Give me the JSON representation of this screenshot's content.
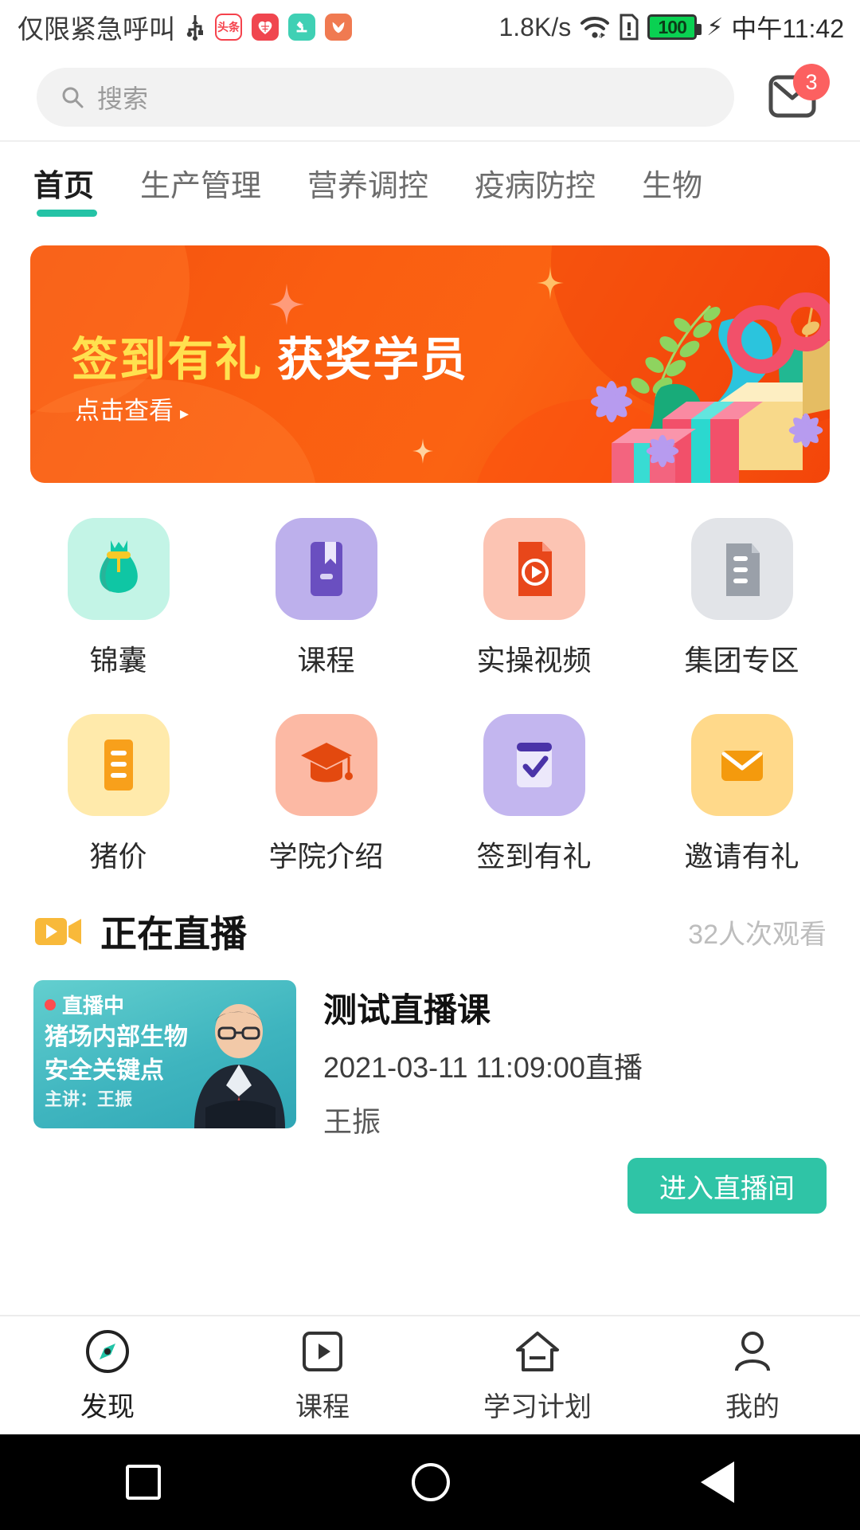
{
  "statusbar": {
    "carrier": "仅限紧急呼叫",
    "usb_icon": "usb-icon",
    "app_icons": [
      {
        "name": "toutiao-icon",
        "label": "头条",
        "bg": "#ffffff",
        "fg": "#f5424c"
      },
      {
        "name": "health-heart-icon",
        "label": "",
        "bg": "#f0464f",
        "fg": "#ffffff"
      },
      {
        "name": "microscope-app-icon",
        "label": "",
        "bg": "#3fd0b4",
        "fg": "#ffffff"
      },
      {
        "name": "plant-app-icon",
        "label": "",
        "bg": "#f07a51",
        "fg": "#ffffff"
      }
    ],
    "network_speed": "1.8K/s",
    "wifi_icon": "wifi-icon",
    "sim_icon": "sim-alert-icon",
    "battery_level": "100",
    "battery_color": "#0ad152",
    "charging_icon": "bolt-icon",
    "time": "中午11:42"
  },
  "search": {
    "placeholder": "搜索",
    "icon": "search-icon",
    "mail_icon": "mail-icon",
    "badge_count": "3",
    "badge_color": "#fc6060"
  },
  "tabs": {
    "active_index": 0,
    "accent": "#25c3a6",
    "items": [
      {
        "label": "首页"
      },
      {
        "label": "生产管理"
      },
      {
        "label": "营养调控"
      },
      {
        "label": "疫病防控"
      },
      {
        "label": "生物"
      }
    ]
  },
  "banner": {
    "title_part1": "签到有礼",
    "title_part2": "获奖学员",
    "subtitle": "点击查看",
    "arrow": "▸",
    "bg_color": "#f4520f",
    "title_color_1": "#ffe14f",
    "title_color_2": "#ffffff"
  },
  "grid": {
    "items": [
      {
        "label": "锦囊",
        "icon": "money-bag-icon",
        "tile_bg": "#c3f4e6",
        "fg": "#14c8a5"
      },
      {
        "label": "课程",
        "icon": "book-icon",
        "tile_bg": "#bdb0ec",
        "fg": "#6a4fc0"
      },
      {
        "label": "实操视频",
        "icon": "video-file-icon",
        "tile_bg": "#fcc4b3",
        "fg": "#e8471a"
      },
      {
        "label": "集团专区",
        "icon": "building-icon",
        "tile_bg": "#e2e4e8",
        "fg": "#9aa0a9"
      },
      {
        "label": "猪价",
        "icon": "list-doc-icon",
        "tile_bg": "#ffeaab",
        "fg": "#f8a01b"
      },
      {
        "label": "学院介绍",
        "icon": "graduation-cap-icon",
        "tile_bg": "#fcb9a4",
        "fg": "#e3490f"
      },
      {
        "label": "签到有礼",
        "icon": "calendar-check-icon",
        "tile_bg": "#c3b6ef",
        "fg": "#4a33a8"
      },
      {
        "label": "邀请有礼",
        "icon": "envelope-icon",
        "tile_bg": "#ffd98a",
        "fg": "#f49a0d"
      }
    ]
  },
  "live": {
    "section_icon": "live-camera-icon",
    "section_title": "正在直播",
    "viewers": "32人次观看",
    "thumb_badge": "直播中",
    "thumb_line1": "猪场内部生物",
    "thumb_line2": "安全关键点",
    "thumb_line3": "主讲：王振",
    "course_title": "测试直播课",
    "course_time": "2021-03-11 11:09:00直播",
    "author": "王振",
    "action_label": "进入直播间",
    "action_color": "#2fc4a6"
  },
  "bottomnav": {
    "active_index": 0,
    "items": [
      {
        "label": "发现",
        "icon": "compass-icon"
      },
      {
        "label": "课程",
        "icon": "play-square-icon"
      },
      {
        "label": "学习计划",
        "icon": "home-plan-icon"
      },
      {
        "label": "我的",
        "icon": "user-icon"
      }
    ]
  },
  "sysnav": {
    "back_icon": "triangle-back-icon",
    "home_icon": "circle-home-icon",
    "recent_icon": "square-recents-icon"
  }
}
